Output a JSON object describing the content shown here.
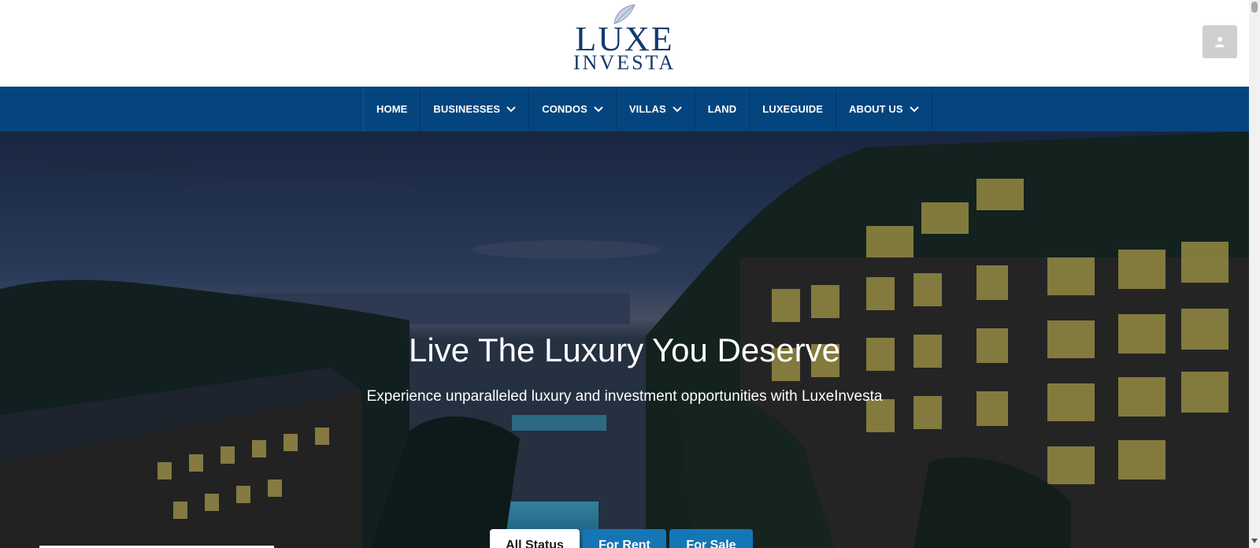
{
  "brand": {
    "logo_line1": "LUXE",
    "logo_line2": "INVESTA",
    "logo_color": "#143a6b"
  },
  "header": {
    "user_button_icon": "user-icon"
  },
  "nav": {
    "background": "#04457f",
    "items": [
      {
        "label": "HOME",
        "has_dropdown": false
      },
      {
        "label": "BUSINESSES",
        "has_dropdown": true
      },
      {
        "label": "CONDOS",
        "has_dropdown": true
      },
      {
        "label": "VILLAS",
        "has_dropdown": true
      },
      {
        "label": "LAND",
        "has_dropdown": false
      },
      {
        "label": "LUXEGUIDE",
        "has_dropdown": false
      },
      {
        "label": "ABOUT US",
        "has_dropdown": true
      }
    ]
  },
  "hero": {
    "title": "Live The Luxury You Deserve",
    "subtitle": "Experience unparalleled luxury and investment opportunities with LuxeInvesta"
  },
  "status_tabs": {
    "items": [
      {
        "label": "All Status",
        "active": true
      },
      {
        "label": "For Rent",
        "active": false
      },
      {
        "label": "For Sale",
        "active": false
      }
    ],
    "accent": "#1576b6"
  }
}
